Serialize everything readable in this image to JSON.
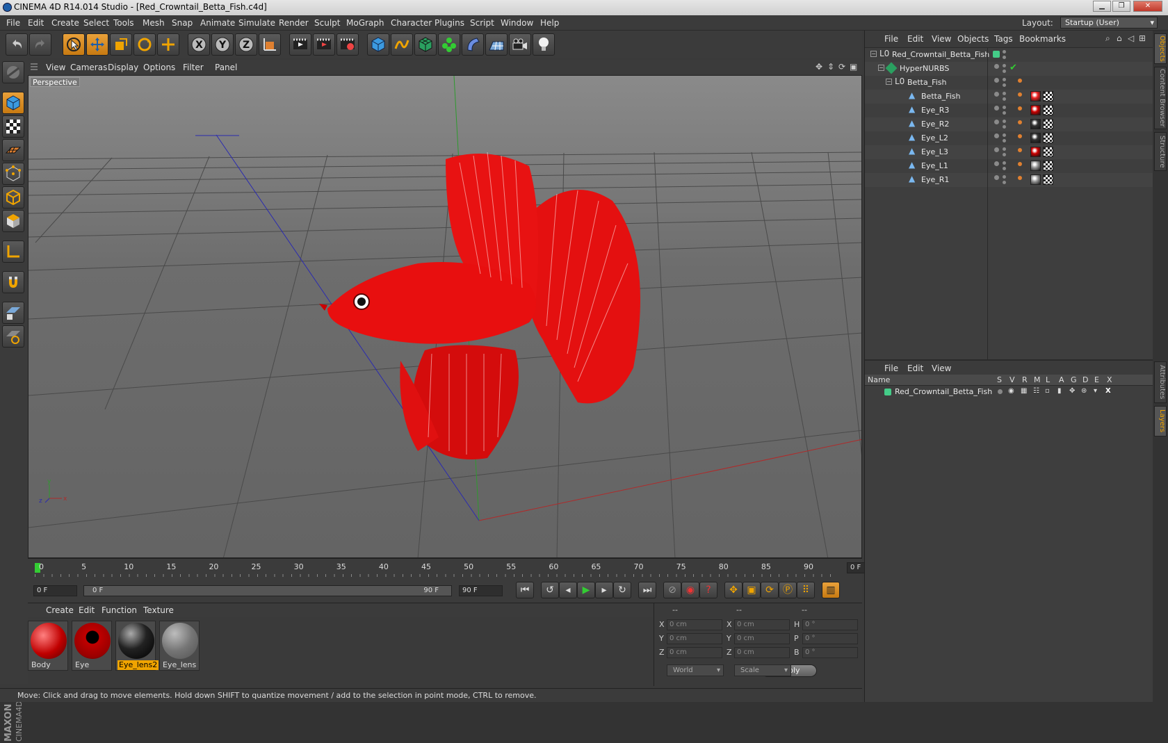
{
  "window": {
    "title": "CINEMA 4D R14.014 Studio - [Red_Crowntail_Betta_Fish.c4d]"
  },
  "menu": [
    "File",
    "Edit",
    "Create",
    "Select",
    "Tools",
    "Mesh",
    "Snap",
    "Animate",
    "Simulate",
    "Render",
    "Sculpt",
    "MoGraph",
    "Character",
    "Plugins",
    "Script",
    "Window",
    "Help"
  ],
  "layout": {
    "label": "Layout:",
    "value": "Startup (User)"
  },
  "viewport": {
    "menu": [
      "View",
      "Cameras",
      "Display",
      "Options",
      "Filter",
      "Panel"
    ],
    "label": "Perspective"
  },
  "timeline": {
    "ticks": [
      "0",
      "5",
      "10",
      "15",
      "20",
      "25",
      "30",
      "35",
      "40",
      "45",
      "50",
      "55",
      "60",
      "65",
      "70",
      "75",
      "80",
      "85",
      "90"
    ],
    "frame": "0 F"
  },
  "transport": {
    "start": "0 F",
    "range_start": "0 F",
    "range_end": "90 F",
    "end": "90 F"
  },
  "materials": {
    "menu": [
      "Create",
      "Edit",
      "Function",
      "Texture"
    ],
    "items": [
      {
        "name": "Body",
        "selected": false
      },
      {
        "name": "Eye",
        "selected": false
      },
      {
        "name": "Eye_lens2",
        "selected": true
      },
      {
        "name": "Eye_lens",
        "selected": false
      }
    ]
  },
  "coords": {
    "head": [
      "--",
      "--",
      "--"
    ],
    "rows": [
      {
        "a": "X",
        "av": "0 cm",
        "b": "X",
        "bv": "0 cm",
        "c": "H",
        "cv": "0 °"
      },
      {
        "a": "Y",
        "av": "0 cm",
        "b": "Y",
        "bv": "0 cm",
        "c": "P",
        "cv": "0 °"
      },
      {
        "a": "Z",
        "av": "0 cm",
        "b": "Z",
        "bv": "0 cm",
        "c": "B",
        "cv": "0 °"
      }
    ],
    "mode1": "World",
    "mode2": "Scale",
    "apply": "Apply"
  },
  "status": "Move: Click and drag to move elements. Hold down SHIFT to quantize movement / add to the selection in point mode, CTRL to remove.",
  "objects": {
    "menu": [
      "File",
      "Edit",
      "View",
      "Objects",
      "Tags",
      "Bookmarks"
    ],
    "tree": [
      {
        "name": "Red_Crowntail_Betta_Fish",
        "indent": 0,
        "type": "null"
      },
      {
        "name": "HyperNURBS",
        "indent": 1,
        "type": "nurbs"
      },
      {
        "name": "Betta_Fish",
        "indent": 2,
        "type": "null"
      },
      {
        "name": "Betta_Fish",
        "indent": 3,
        "type": "poly"
      },
      {
        "name": "Eye_R3",
        "indent": 3,
        "type": "poly"
      },
      {
        "name": "Eye_R2",
        "indent": 3,
        "type": "poly"
      },
      {
        "name": "Eye_L2",
        "indent": 3,
        "type": "poly"
      },
      {
        "name": "Eye_L3",
        "indent": 3,
        "type": "poly"
      },
      {
        "name": "Eye_L1",
        "indent": 3,
        "type": "poly"
      },
      {
        "name": "Eye_R1",
        "indent": 3,
        "type": "poly"
      }
    ]
  },
  "layers": {
    "menu": [
      "File",
      "Edit",
      "View"
    ],
    "cols": [
      "Name",
      "S",
      "V",
      "R",
      "M",
      "L",
      "A",
      "G",
      "D",
      "E",
      "X"
    ],
    "rows": [
      "Red_Crowntail_Betta_Fish"
    ]
  },
  "sidetabs": [
    "Objects",
    "Content Browser",
    "Structure",
    "Attributes",
    "Layers"
  ]
}
